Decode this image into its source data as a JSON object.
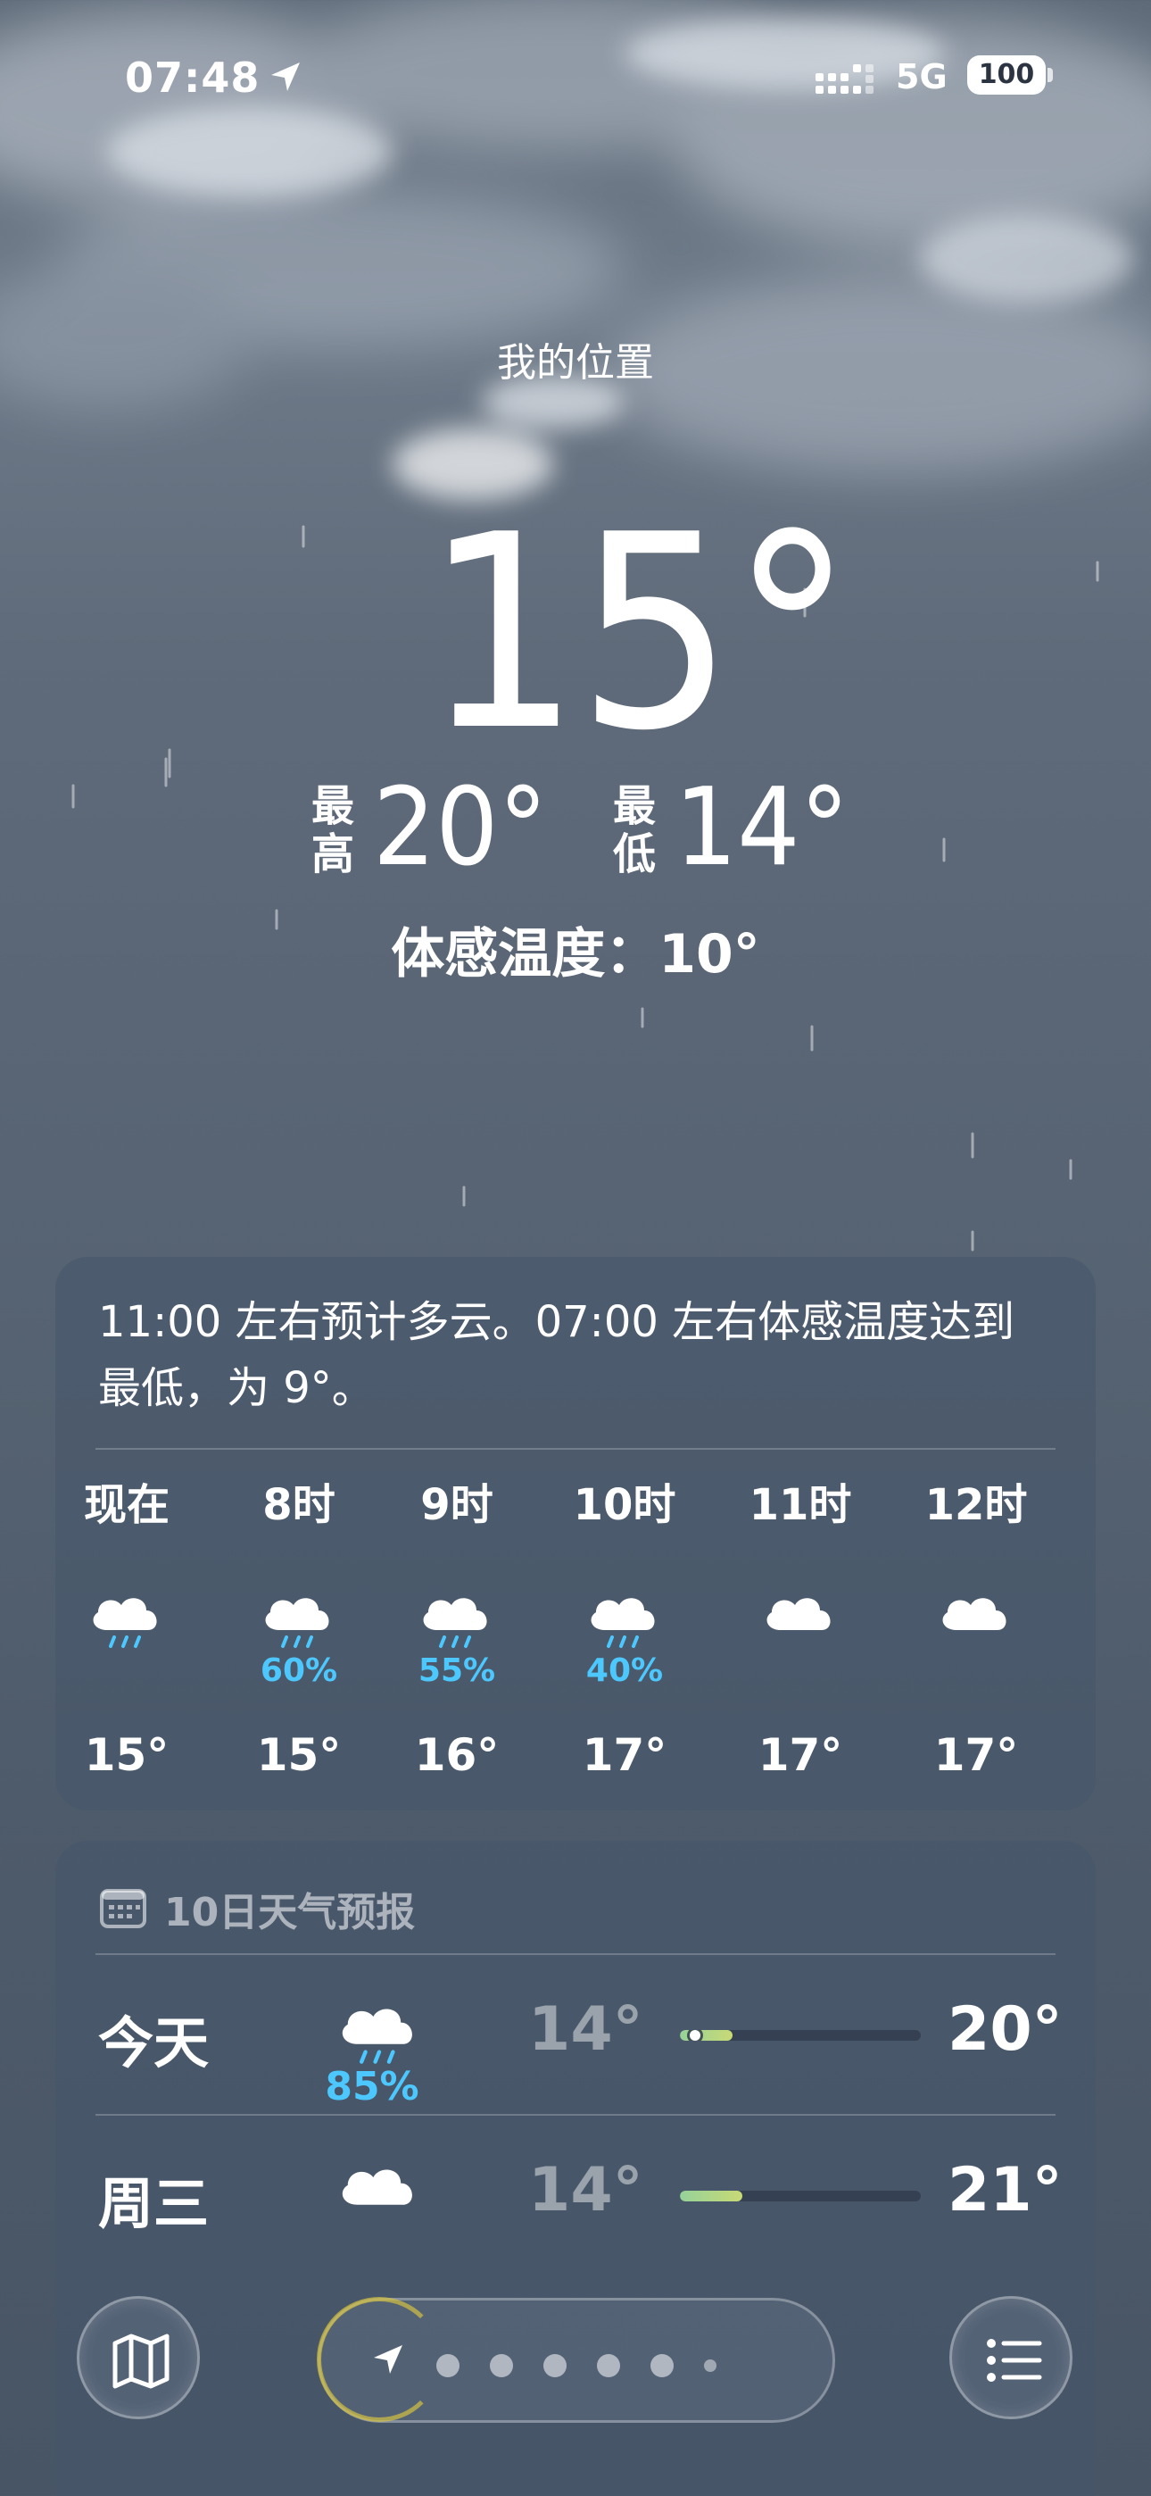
{
  "status_bar": {
    "time": "07:48",
    "network": "5G",
    "battery": "100"
  },
  "header": {
    "location": "我的位置",
    "temperature": "15°",
    "high_label": "最高",
    "high": "20°",
    "low_label": "最低",
    "low": "14°",
    "feels_like": "体感温度：10°"
  },
  "hourly": {
    "summary": "11:00 左右预计多云。07:00 左右体感温度达到最低，为 9°。",
    "items": [
      {
        "label": "现在",
        "icon": "cloud-rain-icon",
        "prob": "",
        "temp": "15°"
      },
      {
        "label": "8时",
        "icon": "cloud-rain-icon",
        "prob": "60%",
        "temp": "15°"
      },
      {
        "label": "9时",
        "icon": "cloud-rain-icon",
        "prob": "55%",
        "temp": "16°"
      },
      {
        "label": "10时",
        "icon": "cloud-rain-icon",
        "prob": "40%",
        "temp": "17°"
      },
      {
        "label": "11时",
        "icon": "cloud-icon",
        "prob": "",
        "temp": "17°"
      },
      {
        "label": "12时",
        "icon": "cloud-icon",
        "prob": "",
        "temp": "17°"
      }
    ]
  },
  "daily": {
    "title": "10日天气预报",
    "days": [
      {
        "name": "今天",
        "icon": "cloud-rain-icon",
        "prob": "85%",
        "low": "14°",
        "high": "20°",
        "range_start": 0.0,
        "range_end": 0.22,
        "current": 0.04
      },
      {
        "name": "周三",
        "icon": "cloud-icon",
        "prob": "",
        "low": "14°",
        "high": "21°",
        "range_start": 0.0,
        "range_end": 0.26
      }
    ]
  },
  "colors": {
    "precip": "#4cc8ff",
    "range_bar": "#c8d975"
  },
  "toolbar": {
    "map": "map-icon",
    "list": "list-icon",
    "page_dots": 7,
    "active_page": 0
  }
}
